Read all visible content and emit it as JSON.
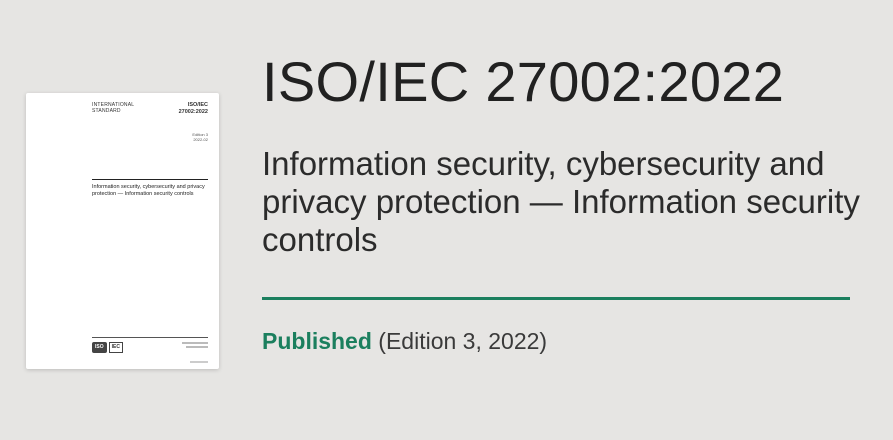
{
  "cover": {
    "type_line1": "INTERNATIONAL",
    "type_line2": "STANDARD",
    "ref_line1": "ISO/IEC",
    "ref_line2": "27002:2022",
    "edition_line1": "Edition 3",
    "edition_line2": "2022-02",
    "title": "Information security, cybersecurity and privacy protection — Information security controls",
    "logo_iso": "ISO",
    "logo_iec": "IEC"
  },
  "standard": {
    "number": "ISO/IEC 27002:2022",
    "title": "Information security, cybersecurity and privacy protection — Information security controls",
    "status": "Published",
    "edition_info": "(Edition 3, 2022)"
  },
  "colors": {
    "accent": "#1b7f5e",
    "background": "#e6e5e3",
    "text": "#212121"
  }
}
